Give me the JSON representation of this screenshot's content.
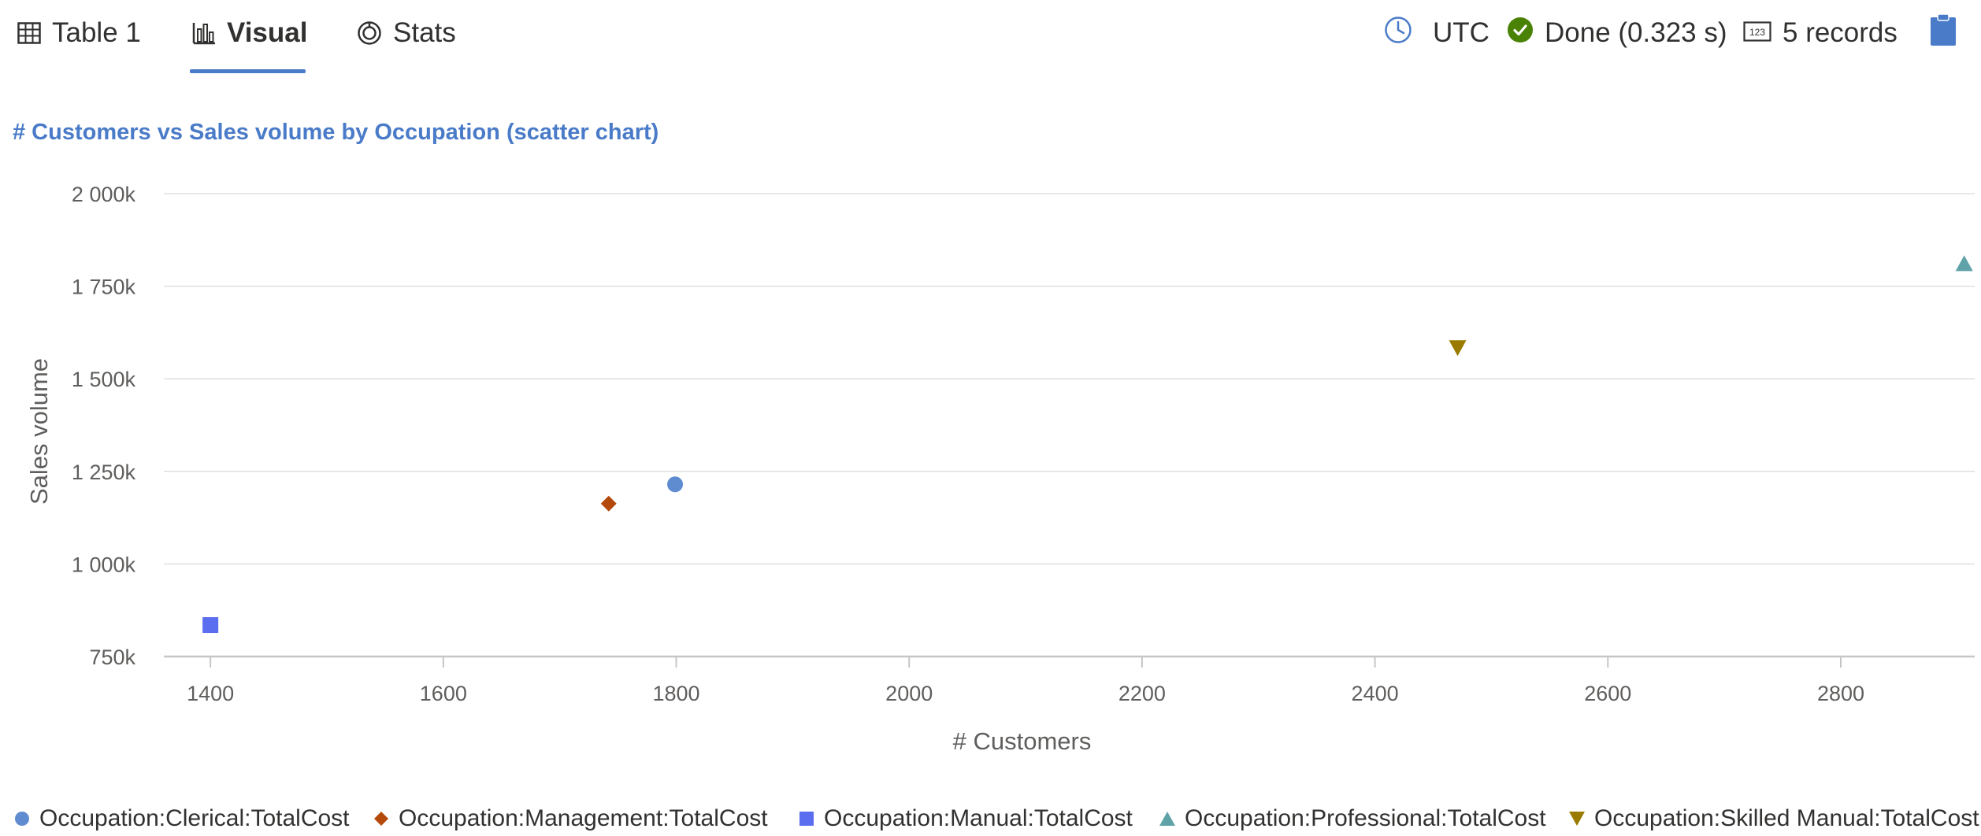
{
  "tabs": [
    {
      "label": "Table 1",
      "icon": "table-icon"
    },
    {
      "label": "Visual",
      "icon": "bar-chart-icon"
    },
    {
      "label": "Stats",
      "icon": "stats-icon"
    }
  ],
  "active_tab": "Visual",
  "status": {
    "timezone": "UTC",
    "done": "Done (0.323 s)",
    "records": "5 records",
    "clipboard_icon": "clipboard-icon"
  },
  "colors": {
    "accent": "#4a7bc8",
    "done_green": "#498205",
    "grid": "#e1dfdd",
    "axis": "#c8c6c4"
  },
  "chart_data": {
    "type": "scatter",
    "title": "# Customers vs Sales volume by Occupation (scatter chart)",
    "xlabel": "# Customers",
    "ylabel": "Sales volume",
    "xlim": [
      1360,
      2915
    ],
    "ylim": [
      750000,
      2000000
    ],
    "xticks": [
      1400,
      1600,
      1800,
      2000,
      2200,
      2400,
      2600,
      2800
    ],
    "xtick_labels": [
      "1400",
      "1600",
      "1800",
      "2000",
      "2200",
      "2400",
      "2600",
      "2800"
    ],
    "yticks": [
      750000,
      1000000,
      1250000,
      1500000,
      1750000,
      2000000
    ],
    "ytick_labels": [
      "750k",
      "1 000k",
      "1 250k",
      "1 500k",
      "1 750k",
      "2 000k"
    ],
    "grid": true,
    "legend_position": "bottom",
    "series": [
      {
        "name": "Occupation:Clerical:TotalCost",
        "marker": "circle",
        "color": "#5f8bd0",
        "x": [
          1799
        ],
        "y": [
          1215000
        ]
      },
      {
        "name": "Occupation:Management:TotalCost",
        "marker": "diamond",
        "color": "#b34a0c",
        "x": [
          1742
        ],
        "y": [
          1163000
        ]
      },
      {
        "name": "Occupation:Manual:TotalCost",
        "marker": "square",
        "color": "#5b6ef0",
        "x": [
          1400
        ],
        "y": [
          835000
        ]
      },
      {
        "name": "Occupation:Professional:TotalCost",
        "marker": "triangle-up",
        "color": "#5fa3a8",
        "x": [
          2906
        ],
        "y": [
          1810000
        ]
      },
      {
        "name": "Occupation:Skilled Manual:TotalCost",
        "marker": "triangle-down",
        "color": "#9a7b00",
        "x": [
          2471
        ],
        "y": [
          1585000
        ]
      }
    ]
  }
}
